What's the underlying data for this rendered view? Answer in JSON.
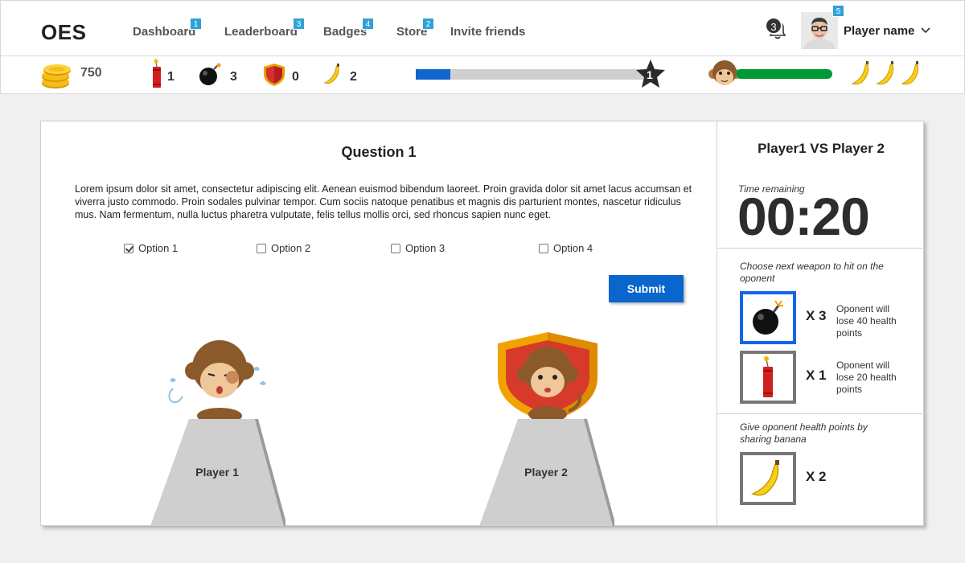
{
  "app": {
    "logo": "OES"
  },
  "nav": [
    {
      "label": "Dashboard",
      "badge": "1"
    },
    {
      "label": "Leaderboard",
      "badge": "3"
    },
    {
      "label": "Badges",
      "badge": "4"
    },
    {
      "label": "Store",
      "badge": "2"
    },
    {
      "label": "Invite friends"
    }
  ],
  "user": {
    "notifications": "3",
    "name": "Player name",
    "avatar_badge": "5"
  },
  "stats": {
    "coins": "750",
    "dynamite": "1",
    "bombs": "3",
    "shields": "0",
    "bananas": "2",
    "level": "1",
    "xp_progress": 0.15,
    "health_progress": 1.0,
    "banana_lives": 3
  },
  "question": {
    "title": "Question 1",
    "text": "Lorem ipsum dolor sit amet, consectetur adipiscing elit. Aenean euismod bibendum laoreet. Proin gravida dolor sit amet lacus accumsan et viverra justo commodo. Proin sodales pulvinar tempor. Cum sociis natoque penatibus et magnis dis parturient montes, nascetur ridiculus mus. Nam fermentum, nulla luctus pharetra vulputate, felis tellus mollis orci, sed rhoncus sapien nunc eget.",
    "options": [
      {
        "label": "Option 1",
        "checked": true
      },
      {
        "label": "Option 2",
        "checked": false
      },
      {
        "label": "Option 3",
        "checked": false
      },
      {
        "label": "Option 4",
        "checked": false
      }
    ],
    "submit_label": "Submit"
  },
  "players": {
    "p1": "Player 1",
    "p2": "Player 2"
  },
  "battle": {
    "title": "Player1 VS Player 2",
    "time_label": "Time remaining",
    "timer": "00:20",
    "weapon_prompt": "Choose next weapon to hit on the oponent",
    "weapons": [
      {
        "icon": "bomb-icon",
        "count": "X 3",
        "desc": "Oponent will lose 40 health points",
        "selected": true
      },
      {
        "icon": "dynamite-icon",
        "count": "X 1",
        "desc": "Oponent will lose 20 health points",
        "selected": false
      }
    ],
    "share_prompt": "Give oponent health points by sharing banana",
    "banana": {
      "icon": "banana-icon",
      "count": "X 2"
    }
  },
  "colors": {
    "primary": "#0a66cc",
    "health": "#009933",
    "callout": "#2ea2d8"
  }
}
